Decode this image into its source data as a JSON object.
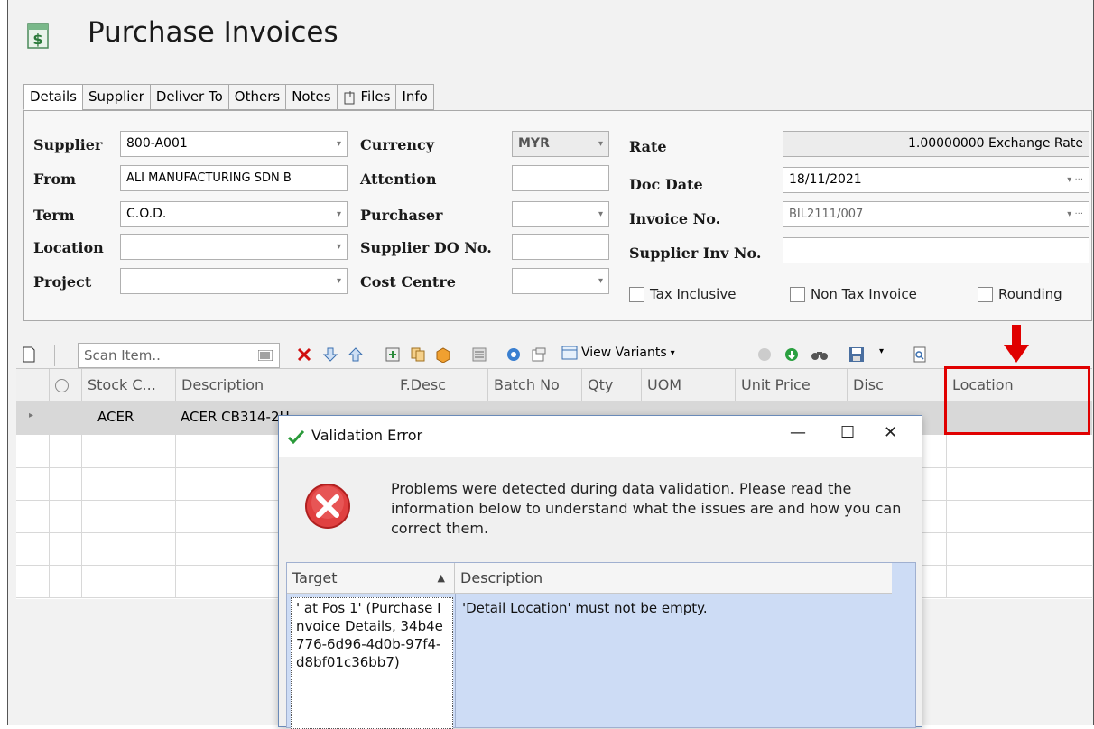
{
  "app": {
    "title": "Purchase Invoices"
  },
  "tabs": [
    {
      "label": "Details"
    },
    {
      "label": "Supplier"
    },
    {
      "label": "Deliver To"
    },
    {
      "label": "Others"
    },
    {
      "label": "Notes"
    },
    {
      "label": "Files"
    },
    {
      "label": "Info"
    }
  ],
  "form": {
    "supplier_label": "Supplier",
    "supplier_value": "800-A001",
    "from_label": "From",
    "from_value": "ALI MANUFACTURING SDN B",
    "term_label": "Term",
    "term_value": "C.O.D.",
    "location_label": "Location",
    "location_value": "",
    "project_label": "Project",
    "project_value": "",
    "currency_label": "Currency",
    "currency_value": "MYR",
    "attention_label": "Attention",
    "attention_value": "",
    "purchaser_label": "Purchaser",
    "purchaser_value": "",
    "supplier_do_label": "Supplier DO No.",
    "supplier_do_value": "",
    "cost_centre_label": "Cost Centre",
    "cost_centre_value": "",
    "rate_label": "Rate",
    "rate_value": "1.00000000 Exchange Rate",
    "doc_date_label": "Doc Date",
    "doc_date_value": "18/11/2021",
    "invoice_no_label": "Invoice No.",
    "invoice_no_value": "BIL2111/007",
    "supplier_inv_label": "Supplier Inv No.",
    "supplier_inv_value": "",
    "tax_inclusive_label": "Tax Inclusive",
    "non_tax_label": "Non Tax Invoice",
    "rounding_label": "Rounding"
  },
  "toolbar": {
    "scan_placeholder": "Scan Item..",
    "view_variants_label": "View Variants"
  },
  "grid": {
    "columns": [
      "Stock C...",
      "Description",
      "F.Desc",
      "Batch No",
      "Qty",
      "UOM",
      "Unit Price",
      "Disc",
      "Location"
    ],
    "rows": [
      {
        "stock_code": "ACER",
        "description": "ACER CB314-2H"
      }
    ]
  },
  "dialog": {
    "title": "Validation Error",
    "message": "Problems were detected during data validation. Please read the information below to understand what the issues are and how you can correct them.",
    "col_target": "Target",
    "col_description": "Description",
    "row_target": "' at Pos 1' (Purchase Invoice Details, 34b4e776-6d96-4d0b-97f4-d8bf01c36bb7)",
    "row_description": "'Detail Location' must not be empty."
  },
  "colors": {
    "highlight_red": "#e00000",
    "dialog_table_bg": "#cddcf5"
  }
}
